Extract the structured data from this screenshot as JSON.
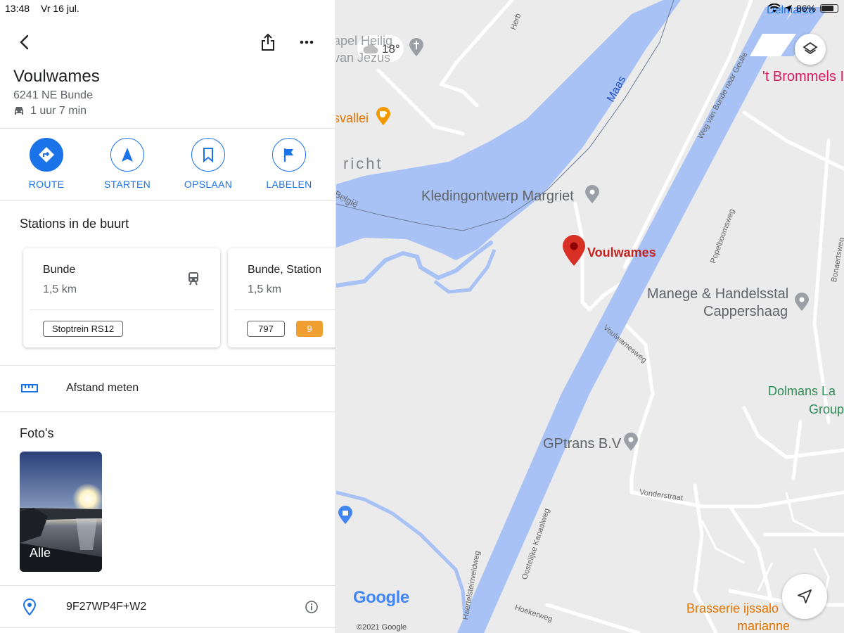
{
  "status_bar": {
    "time": "13:48",
    "date": "Vr 16 jul.",
    "battery": "86%"
  },
  "place": {
    "name": "Voulwames",
    "address": "6241 NE Bunde",
    "travel_time": "1 uur 7 min"
  },
  "actions": [
    {
      "label": "ROUTE",
      "icon": "directions-icon"
    },
    {
      "label": "STARTEN",
      "icon": "navigation-icon"
    },
    {
      "label": "OPSLAAN",
      "icon": "bookmark-icon"
    },
    {
      "label": "LABELEN",
      "icon": "flag-icon"
    }
  ],
  "stations": {
    "title": "Stations in de buurt",
    "cards": [
      {
        "name": "Bunde",
        "distance": "1,5 km",
        "chips": [
          "Stoptrein RS12"
        ]
      },
      {
        "name": "Bunde, Station",
        "distance": "1,5 km",
        "chips": [
          "797",
          "9"
        ]
      }
    ]
  },
  "measure": {
    "label": "Afstand meten"
  },
  "photos": {
    "title": "Foto's",
    "all_label": "Alle"
  },
  "plus_code": {
    "value": "9F27WP4F+W2"
  },
  "map": {
    "weather": "18°",
    "river": "Maas",
    "country": "België",
    "selected_label": "Voulwames",
    "pois": {
      "kleding": "Kledingontwerp Margriet",
      "manege_1": "Manege & Handelsstal",
      "manege_2": "Cappershaag",
      "gptrans": "GPtrans B.V",
      "dolmans_1": "Dolmans La",
      "dolmans_2": "Group",
      "brommels": "'t Brommels I",
      "brasserie_1": "Brasserie ijssalo",
      "brasserie_2": "marianne",
      "vallei": "svallei",
      "kapel_1": "apel Heilig",
      "kapel_2": "van Jezus",
      "dellmarco": "Delmarco",
      "richt": "richt"
    },
    "streets": {
      "weg_van_bunde": "Weg van Bunde naar Geulle",
      "popelboomsweg": "Popelboomsweg",
      "bonaertsweg": "Bonaertsweg",
      "voulwamesweg": "Voulwamesweg",
      "vonderstraat": "Vonderstraat",
      "oostelijke": "Oostelijke Kanaalweg",
      "haertelstein": "Haertelsteinveldweg",
      "hoekerweg": "Hoekerweg",
      "herb": "Herb"
    },
    "google_logo": "Google",
    "copyright": "©2021 Google",
    "colors": {
      "water": "#a8c2f5",
      "land": "#ebebeb",
      "road": "#ffffff",
      "pin": "#d93025",
      "accent": "#1a73e8"
    }
  }
}
